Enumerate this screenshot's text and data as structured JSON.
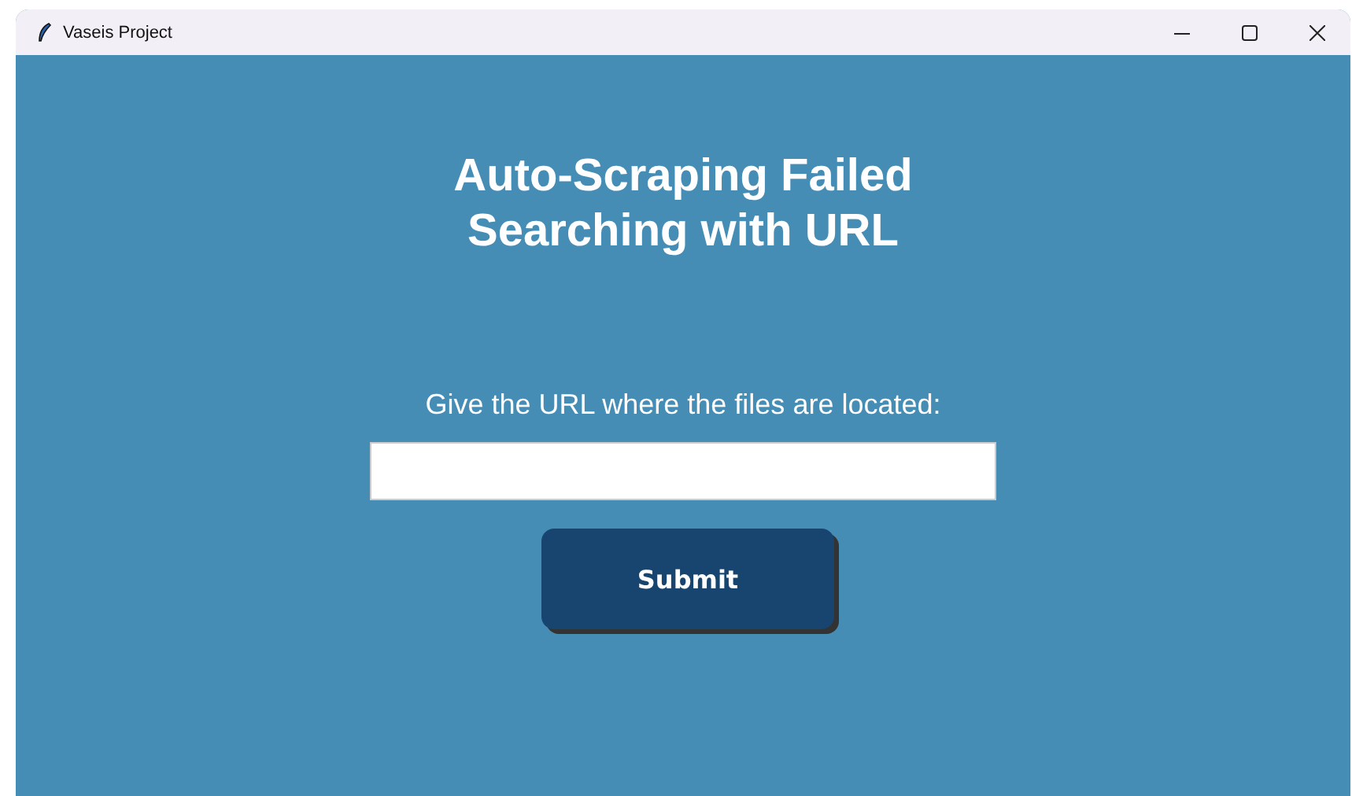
{
  "window": {
    "title": "Vaseis Project"
  },
  "heading": [
    "Auto-Scraping Failed",
    "Searching with URL"
  ],
  "prompt": "Give the URL where the files are located:",
  "button": {
    "label": "Submit"
  }
}
